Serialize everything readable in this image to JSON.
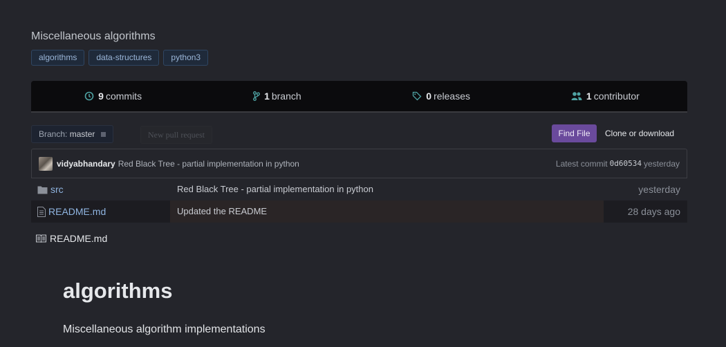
{
  "repo": {
    "description": "Miscellaneous algorithms",
    "topics": [
      "algorithms",
      "data-structures",
      "python3"
    ]
  },
  "summary": {
    "commits_count": "9",
    "commits_label": "commits",
    "branches_count": "1",
    "branches_label": "branch",
    "releases_count": "0",
    "releases_label": "releases",
    "contributors_count": "1",
    "contributors_label": "contributor"
  },
  "toolbar": {
    "branch_prefix": "Branch:",
    "branch_name": "master",
    "new_pr_label": "New pull request",
    "find_file_label": "Find File",
    "clone_label": "Clone or download"
  },
  "latest_commit": {
    "author": "vidyabhandary",
    "message": "Red Black Tree - partial implementation in python",
    "prefix": "Latest commit",
    "sha": "0d60534",
    "age": "yesterday"
  },
  "files": [
    {
      "name": "src",
      "type": "folder",
      "message": "Red Black Tree - partial implementation in python",
      "age": "yesterday"
    },
    {
      "name": "README.md",
      "type": "file",
      "message": "Updated the README",
      "age": "28 days ago"
    }
  ],
  "readme": {
    "filename": "README.md",
    "title": "algorithms",
    "body": "Miscellaneous algorithm implementations"
  },
  "colors": {
    "background": "#24252b",
    "accent": "#6a4a9c",
    "link": "#8fb4e0"
  }
}
